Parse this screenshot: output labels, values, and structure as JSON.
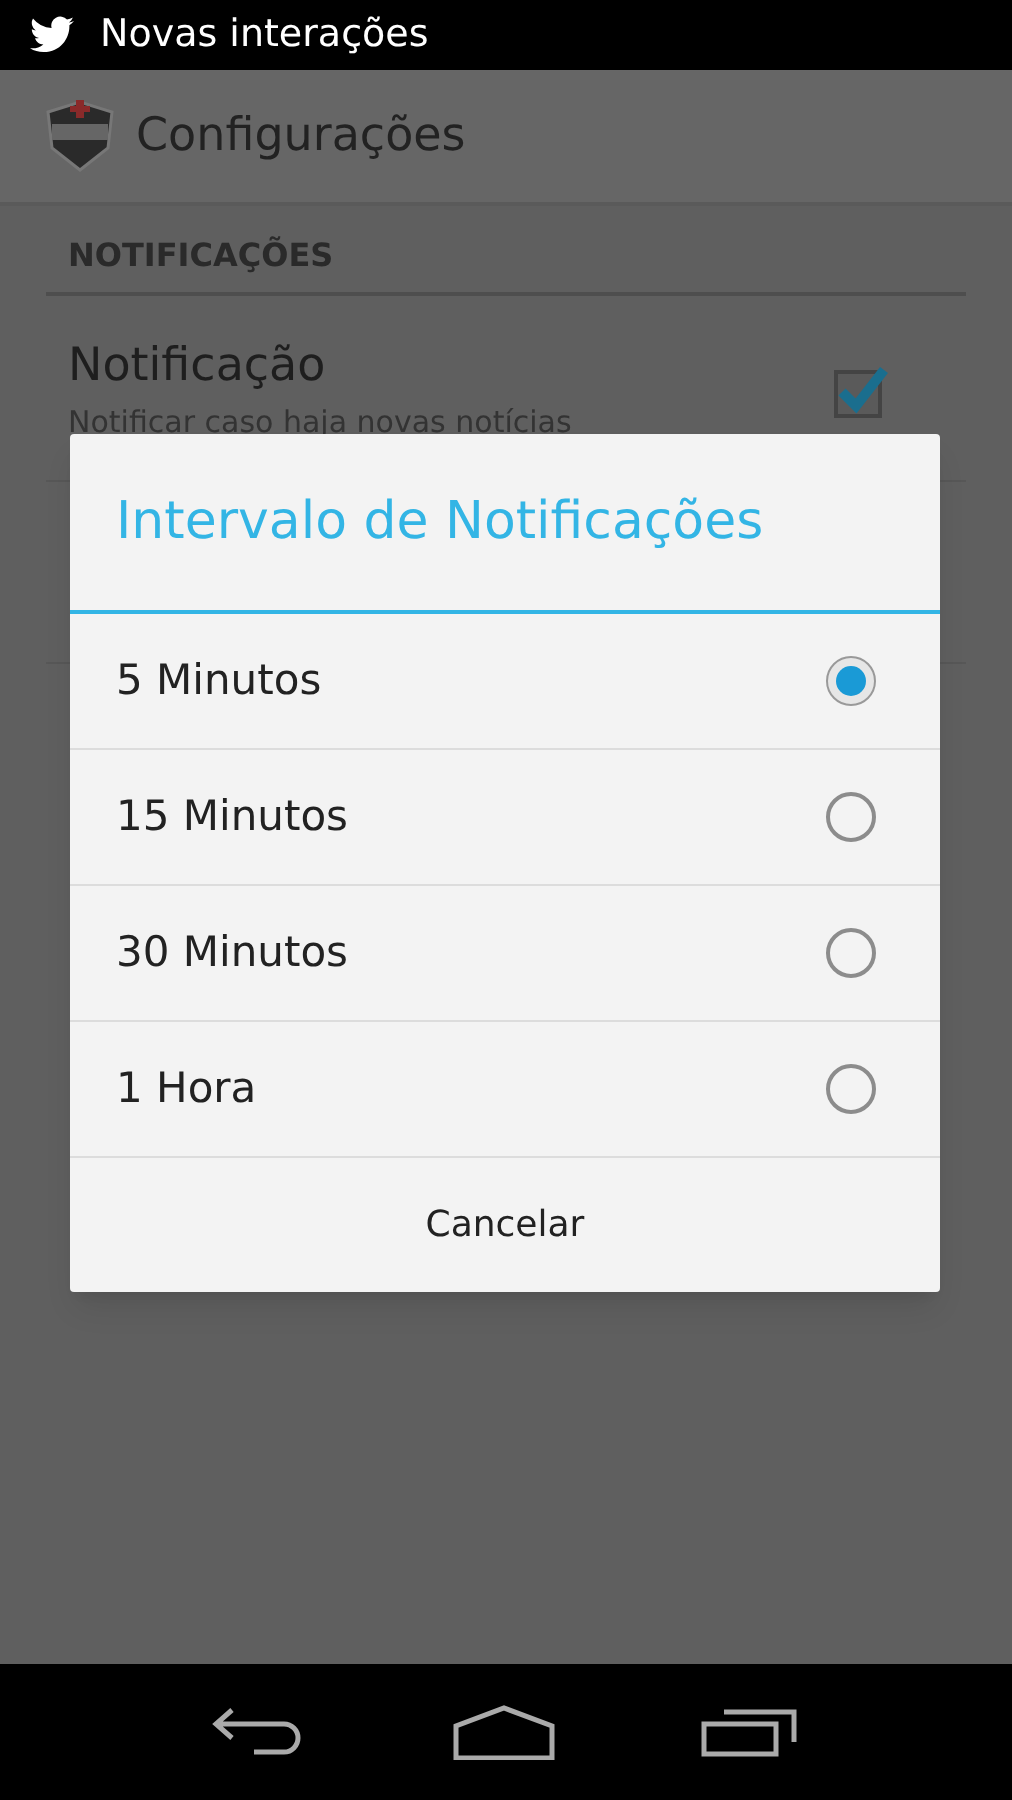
{
  "status_bar": {
    "notification": "Novas interações"
  },
  "action_bar": {
    "title": "Configurações"
  },
  "category": {
    "title": "NOTIFICAÇÕES"
  },
  "preferences": [
    {
      "title": "Notificação",
      "summary": "Notificar caso haja novas notícias",
      "checked": true
    }
  ],
  "dialog": {
    "title": "Intervalo de Notificações",
    "options": [
      {
        "label": "5 Minutos",
        "selected": true
      },
      {
        "label": "15 Minutos",
        "selected": false
      },
      {
        "label": "30 Minutos",
        "selected": false
      },
      {
        "label": "1 Hora",
        "selected": false
      }
    ],
    "buttons": [
      "Cancelar"
    ]
  }
}
